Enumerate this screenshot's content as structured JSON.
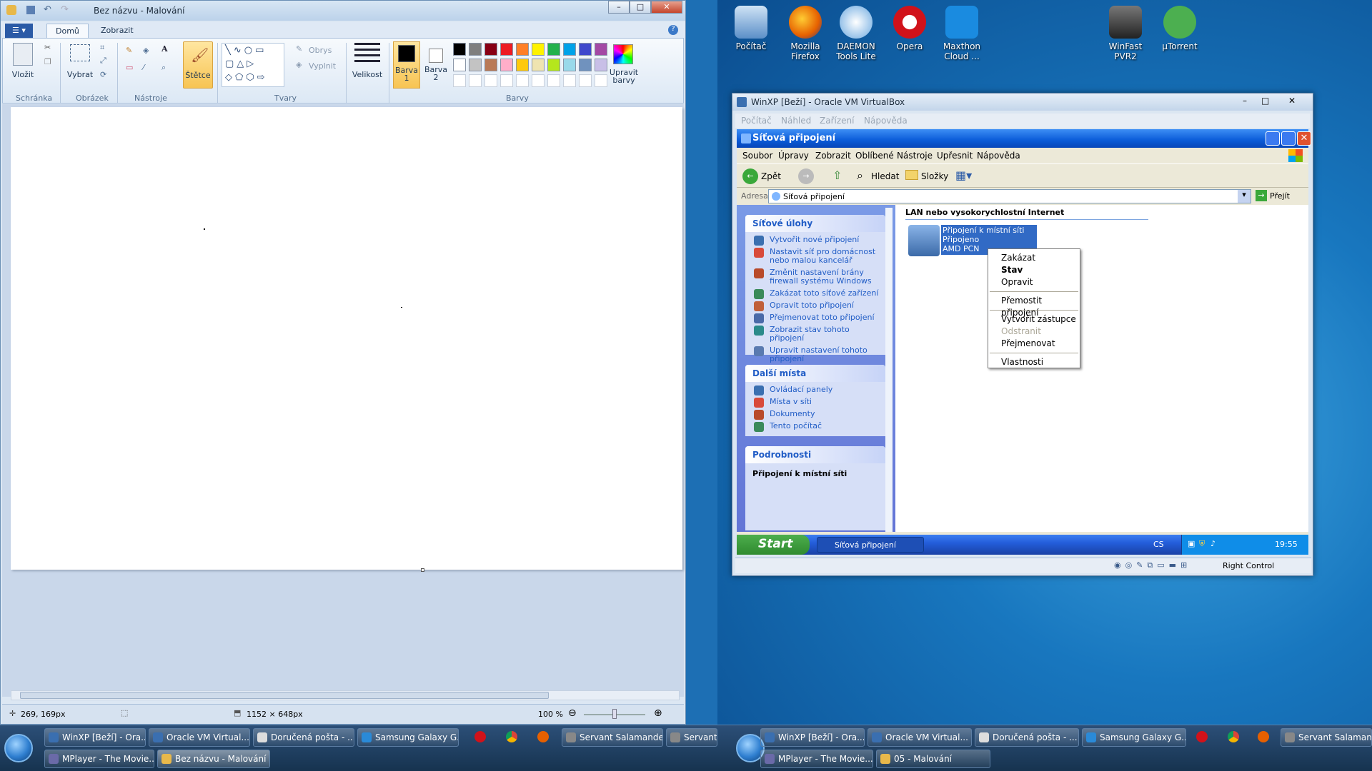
{
  "paint": {
    "title": "Bez názvu - Malování",
    "tabs": [
      "Domů",
      "Zobrazit"
    ],
    "groups": {
      "clipboard": "Schránka",
      "image": "Obrázek",
      "tools": "Nástroje",
      "shapes": "Tvary",
      "colors": "Barvy"
    },
    "buttons": {
      "paste": "Vložit",
      "select": "Vybrat",
      "brushes": "Štětce",
      "outline": "Obrys",
      "fill": "Vyplnit",
      "size": "Velikost",
      "color1": "Barva\n1",
      "color2": "Barva\n2",
      "edit_colors": "Upravit barvy"
    },
    "palette": [
      "#000000",
      "#7f7f7f",
      "#880015",
      "#ed1c24",
      "#ff7f27",
      "#fff200",
      "#22b14c",
      "#00a2e8",
      "#3f48cc",
      "#a349a4",
      "#ffffff",
      "#c3c3c3",
      "#b97a57",
      "#ffaec9",
      "#ffc90e",
      "#efe4b0",
      "#b5e61d",
      "#99d9ea",
      "#7092be",
      "#c8bfe7"
    ],
    "status": {
      "cursor": "269, 169px",
      "size": "1152 × 648px",
      "zoom": "100 %"
    }
  },
  "desktop": {
    "icons": [
      "Počítač",
      "Mozilla Firefox",
      "DAEMON Tools Lite",
      "Opera",
      "Maxthon Cloud ...",
      "WinFast PVR2",
      "µTorrent"
    ]
  },
  "vbox": {
    "title": "WinXP [Beží] - Oracle VM VirtualBox",
    "menu": [
      "Počítač",
      "Náhled",
      "Zařízení",
      "Nápověda"
    ],
    "status_right": "Right Control"
  },
  "xp": {
    "title": "Síťová připojení",
    "menu": [
      "Soubor",
      "Úpravy",
      "Zobrazit",
      "Oblíbené",
      "Nástroje",
      "Upřesnit",
      "Nápověda"
    ],
    "toolbar": {
      "back": "Zpět",
      "search": "Hledat",
      "folders": "Složky"
    },
    "address_label": "Adresa",
    "address": "Síťová připojení",
    "go": "Přejít",
    "panels": [
      {
        "title": "Síťové úlohy",
        "links": [
          "Vytvořit nové připojení",
          "Nastavit síť pro domácnost nebo malou kancelář",
          "Změnit nastavení brány firewall systému Windows",
          "Zakázat toto síťové zařízení",
          "Opravit toto připojení",
          "Přejmenovat toto připojení",
          "Zobrazit stav tohoto připojení",
          "Upravit nastavení tohoto připojení"
        ]
      },
      {
        "title": "Další místa",
        "links": [
          "Ovládací panely",
          "Místa v síti",
          "Dokumenty",
          "Tento počítač"
        ]
      },
      {
        "title": "Podrobnosti",
        "links": [
          "Připojení k místní síti"
        ]
      }
    ],
    "group_header": "LAN nebo vysokorychlostní Internet",
    "connection": {
      "name": "Připojení k místní síti",
      "line2": "Připojeno",
      "line3": "AMD PCN"
    },
    "context_menu": [
      "Zakázat",
      "Stav",
      "Opravit",
      "Přemostit připojení",
      "Vytvořit zástupce",
      "Odstranit",
      "Přejmenovat",
      "Vlastnosti"
    ],
    "start": "Start",
    "task": "Síťová připojení",
    "lang": "CS",
    "clock": "19:55"
  },
  "taskbar_left": {
    "row1": [
      "WinXP [Beží] - Ora...",
      "Oracle VM Virtual...",
      "Doručená pošta - ...",
      "Samsung Galaxy G...",
      "Servant Salamander",
      "Servant S"
    ],
    "row2": [
      "MPlayer - The Movie...",
      "Bez názvu - Malování"
    ]
  },
  "taskbar_right": {
    "row1": [
      "WinXP [Beží] - Ora...",
      "Oracle VM Virtual...",
      "Doručená pošta - ...",
      "Samsung Galaxy G...",
      "Servant Salamander"
    ],
    "row2": [
      "MPlayer - The Movie...",
      "05 - Malování"
    ]
  }
}
